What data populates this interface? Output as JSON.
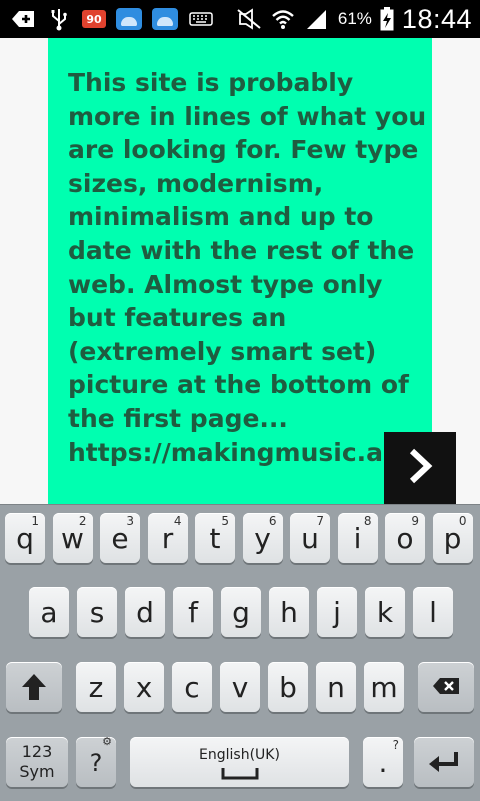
{
  "status_bar": {
    "notification_count": "90",
    "battery_percent": "61%",
    "time": "18:44"
  },
  "content": {
    "body_text": "This site is probably more in lines of what you are looking for. Few type sizes, modernism, minimalism and up to date with the rest of the web. Almost type only but features an (extremely smart set) picture at the bottom of the first page... https://makingmusic.ableton.com",
    "next_icon": "chevron-right-icon",
    "panel_color": "#00ffb0",
    "text_color": "#1f5c40"
  },
  "keyboard": {
    "row1": [
      {
        "label": "q",
        "hint": "1"
      },
      {
        "label": "w",
        "hint": "2"
      },
      {
        "label": "e",
        "hint": "3"
      },
      {
        "label": "r",
        "hint": "4"
      },
      {
        "label": "t",
        "hint": "5"
      },
      {
        "label": "y",
        "hint": "6"
      },
      {
        "label": "u",
        "hint": "7"
      },
      {
        "label": "i",
        "hint": "8"
      },
      {
        "label": "o",
        "hint": "9"
      },
      {
        "label": "p",
        "hint": "0"
      }
    ],
    "row2": [
      "a",
      "s",
      "d",
      "f",
      "g",
      "h",
      "j",
      "k",
      "l"
    ],
    "row3": [
      "z",
      "x",
      "c",
      "v",
      "b",
      "n",
      "m"
    ],
    "sym_label_top": "123",
    "sym_label_bottom": "Sym",
    "question_key": "?",
    "space_label": "English(UK)",
    "period_key": ".",
    "period_hint": "?"
  }
}
